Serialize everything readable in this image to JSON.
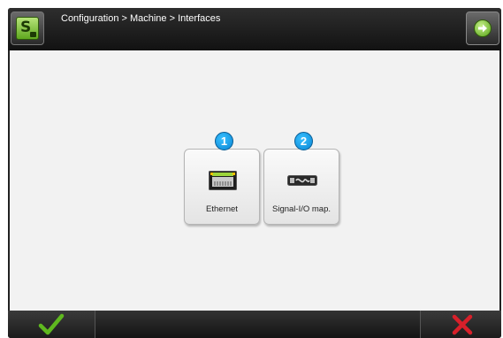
{
  "header": {
    "breadcrumb": "Configuration > Machine > Interfaces",
    "logo_icon": "s-logo-icon",
    "next_icon": "arrow-right-circle-icon"
  },
  "tiles": [
    {
      "number": "1",
      "label": "Ethernet",
      "icon": "ethernet-port-icon"
    },
    {
      "number": "2",
      "label": "Signal-I/O map.",
      "icon": "signal-io-map-icon"
    }
  ],
  "footer": {
    "ok_icon": "checkmark-icon",
    "cancel_icon": "cross-icon"
  },
  "colors": {
    "badge": "#0a86d4",
    "accept_green": "#5fb81f",
    "cancel_red": "#d8202a",
    "content_background": "#f2f2f2",
    "chrome_dark": "#1a1a1a"
  }
}
